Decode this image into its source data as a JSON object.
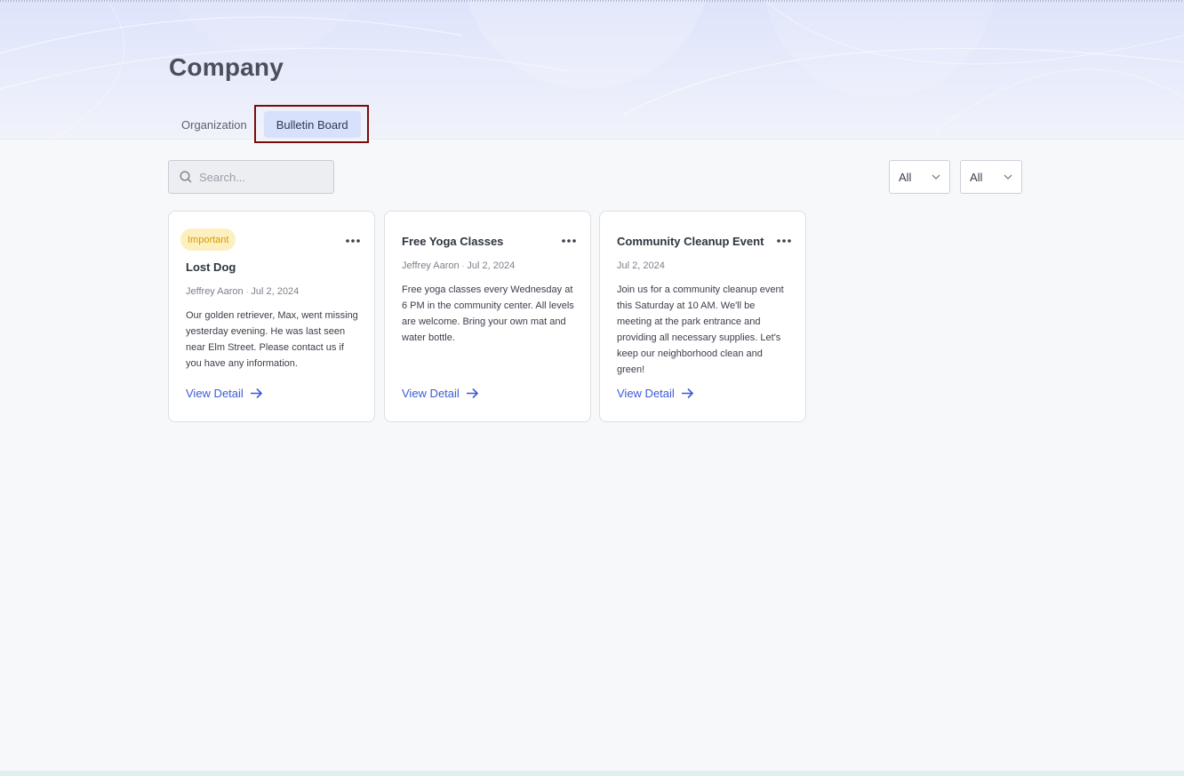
{
  "page": {
    "title": "Company"
  },
  "tabs": [
    {
      "label": "Organization",
      "active": false
    },
    {
      "label": "Bulletin Board",
      "active": true
    }
  ],
  "search": {
    "placeholder": "Search...",
    "icon": "search-icon"
  },
  "filters": [
    {
      "value": "All",
      "icon": "chevron-down-icon"
    },
    {
      "value": "All",
      "icon": "chevron-down-icon"
    }
  ],
  "colors": {
    "accent": "#3b5bd6",
    "badge_bg": "#fdf0c0",
    "badge_text": "#d59a07",
    "active_tab_bg": "#d7e1fb",
    "highlight_border": "#7a0b0b"
  },
  "cards": [
    {
      "badge": "Important",
      "title": "Lost Dog",
      "author": "Jeffrey Aaron",
      "date": "Jul 2, 2024",
      "body": "Our golden retriever, Max, went missing yesterday evening. He was last seen near Elm Street. Please contact us if you have any information.",
      "link": "View Detail"
    },
    {
      "title": "Free Yoga Classes",
      "author": "Jeffrey Aaron",
      "date": "Jul 2, 2024",
      "body": "Free yoga classes every Wednesday at 6 PM in the community center. All levels are welcome. Bring your own mat and water bottle.",
      "link": "View Detail"
    },
    {
      "title": "Community Cleanup Event",
      "date": "Jul 2, 2024",
      "body": "Join us for a community cleanup event this Saturday at 10 AM. We'll be meeting at the park entrance and providing all necessary supplies. Let's keep our neighborhood clean and green!",
      "link": "View Detail"
    }
  ]
}
